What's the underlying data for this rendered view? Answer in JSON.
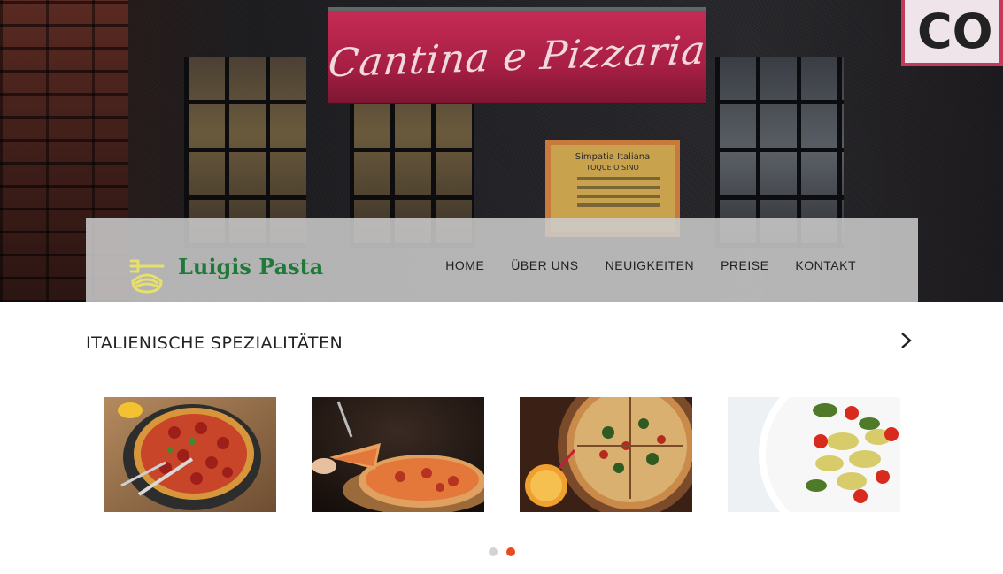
{
  "hero": {
    "sign_text": "Cantina e Pizzaria",
    "poster_title": "Simpatia Italiana",
    "poster_subtitle": "TOQUE O SINO",
    "corner_sign_text": "CO"
  },
  "header": {
    "brand_name": "Luigis Pasta",
    "logo_icon": "pasta-bowl-icon"
  },
  "nav": {
    "items": [
      {
        "label": "HOME"
      },
      {
        "label": "ÜBER UNS"
      },
      {
        "label": "NEUIGKEITEN"
      },
      {
        "label": "PREISE"
      },
      {
        "label": "KONTAKT"
      }
    ]
  },
  "section": {
    "title": "ITALIENISCHE SPEZIALITÄTEN",
    "next_icon": "chevron-right-icon"
  },
  "carousel": {
    "images": [
      {
        "subject": "pepperoni-pizza"
      },
      {
        "subject": "pizza-slice-lift"
      },
      {
        "subject": "pizza-with-drink"
      },
      {
        "subject": "pasta-salad"
      }
    ],
    "page_count": 2,
    "active_page": 2
  },
  "colors": {
    "brand_green": "#1f7a3a",
    "logo_yellow": "#e7e06a",
    "dot_active": "#e84c1a",
    "dot_inactive": "#d3d3d3"
  }
}
